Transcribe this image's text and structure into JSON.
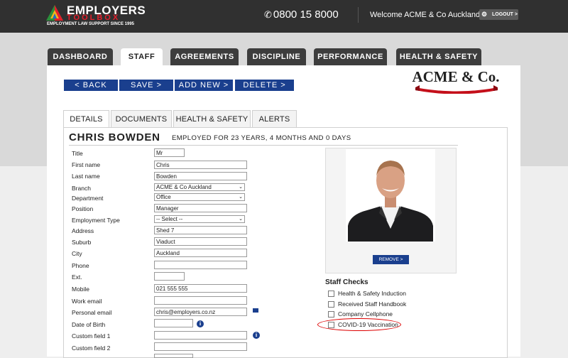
{
  "header": {
    "logo_top": "EMPLOYERS",
    "logo_mid": "TOOLBOX",
    "logo_tagline": "EMPLOYMENT LAW SUPPORT SINCE 1995",
    "phone": "0800 15 8000",
    "welcome": "Welcome ACME & Co Auckland",
    "logout_label": "LOGOUT >"
  },
  "main_tabs": [
    {
      "label": "DASHBOARD"
    },
    {
      "label": "STAFF"
    },
    {
      "label": "AGREEMENTS"
    },
    {
      "label": "DISCIPLINE"
    },
    {
      "label": "PERFORMANCE"
    },
    {
      "label": "HEALTH & SAFETY"
    }
  ],
  "active_main_tab": "STAFF",
  "actions": {
    "back": "< BACK",
    "save": "SAVE >",
    "add_new": "ADD NEW >",
    "delete": "DELETE >"
  },
  "company_logo": {
    "name": "ACME & Co."
  },
  "sub_tabs": [
    {
      "label": "DETAILS"
    },
    {
      "label": "DOCUMENTS"
    },
    {
      "label": "HEALTH & SAFETY"
    },
    {
      "label": "ALERTS"
    }
  ],
  "active_sub_tab": "DETAILS",
  "employee": {
    "name": "CHRIS BOWDEN",
    "employed": "EMPLOYED FOR 23 YEARS, 4 MONTHS AND 0 DAYS"
  },
  "form": {
    "title": {
      "label": "Title",
      "value": "Mr"
    },
    "first_name": {
      "label": "First name",
      "value": "Chris"
    },
    "last_name": {
      "label": "Last name",
      "value": "Bowden"
    },
    "branch": {
      "label": "Branch",
      "value": "ACME & Co Auckland"
    },
    "department": {
      "label": "Department",
      "value": "Office"
    },
    "position": {
      "label": "Position",
      "value": "Manager"
    },
    "employment_type": {
      "label": "Employment Type",
      "value": "-- Select --"
    },
    "address": {
      "label": "Address",
      "value": "Shed 7"
    },
    "suburb": {
      "label": "Suburb",
      "value": "Viaduct"
    },
    "city": {
      "label": "City",
      "value": "Auckland"
    },
    "phone": {
      "label": "Phone",
      "value": ""
    },
    "ext": {
      "label": "Ext.",
      "value": ""
    },
    "mobile": {
      "label": "Mobile",
      "value": "021 555 555"
    },
    "work_email": {
      "label": "Work email",
      "value": ""
    },
    "personal_email": {
      "label": "Personal email",
      "value": "chris@employers.co.nz"
    },
    "date_of_birth": {
      "label": "Date of Birth",
      "value": ""
    },
    "custom_field_1": {
      "label": "Custom field 1",
      "value": ""
    },
    "custom_field_2": {
      "label": "Custom field 2",
      "value": ""
    }
  },
  "photo": {
    "remove_label": "REMOVE >"
  },
  "staff_checks": {
    "title": "Staff Checks",
    "items": [
      {
        "label": "Health & Safety Induction",
        "checked": false
      },
      {
        "label": "Received Staff Handbook",
        "checked": false
      },
      {
        "label": "Company Cellphone",
        "checked": false
      },
      {
        "label": "COVID-19 Vaccination",
        "checked": false
      }
    ]
  },
  "colors": {
    "topbar": "#303030",
    "action_blue": "#1a3f8e",
    "highlight_red": "#dd0000",
    "logo_red": "#e41f2b"
  }
}
